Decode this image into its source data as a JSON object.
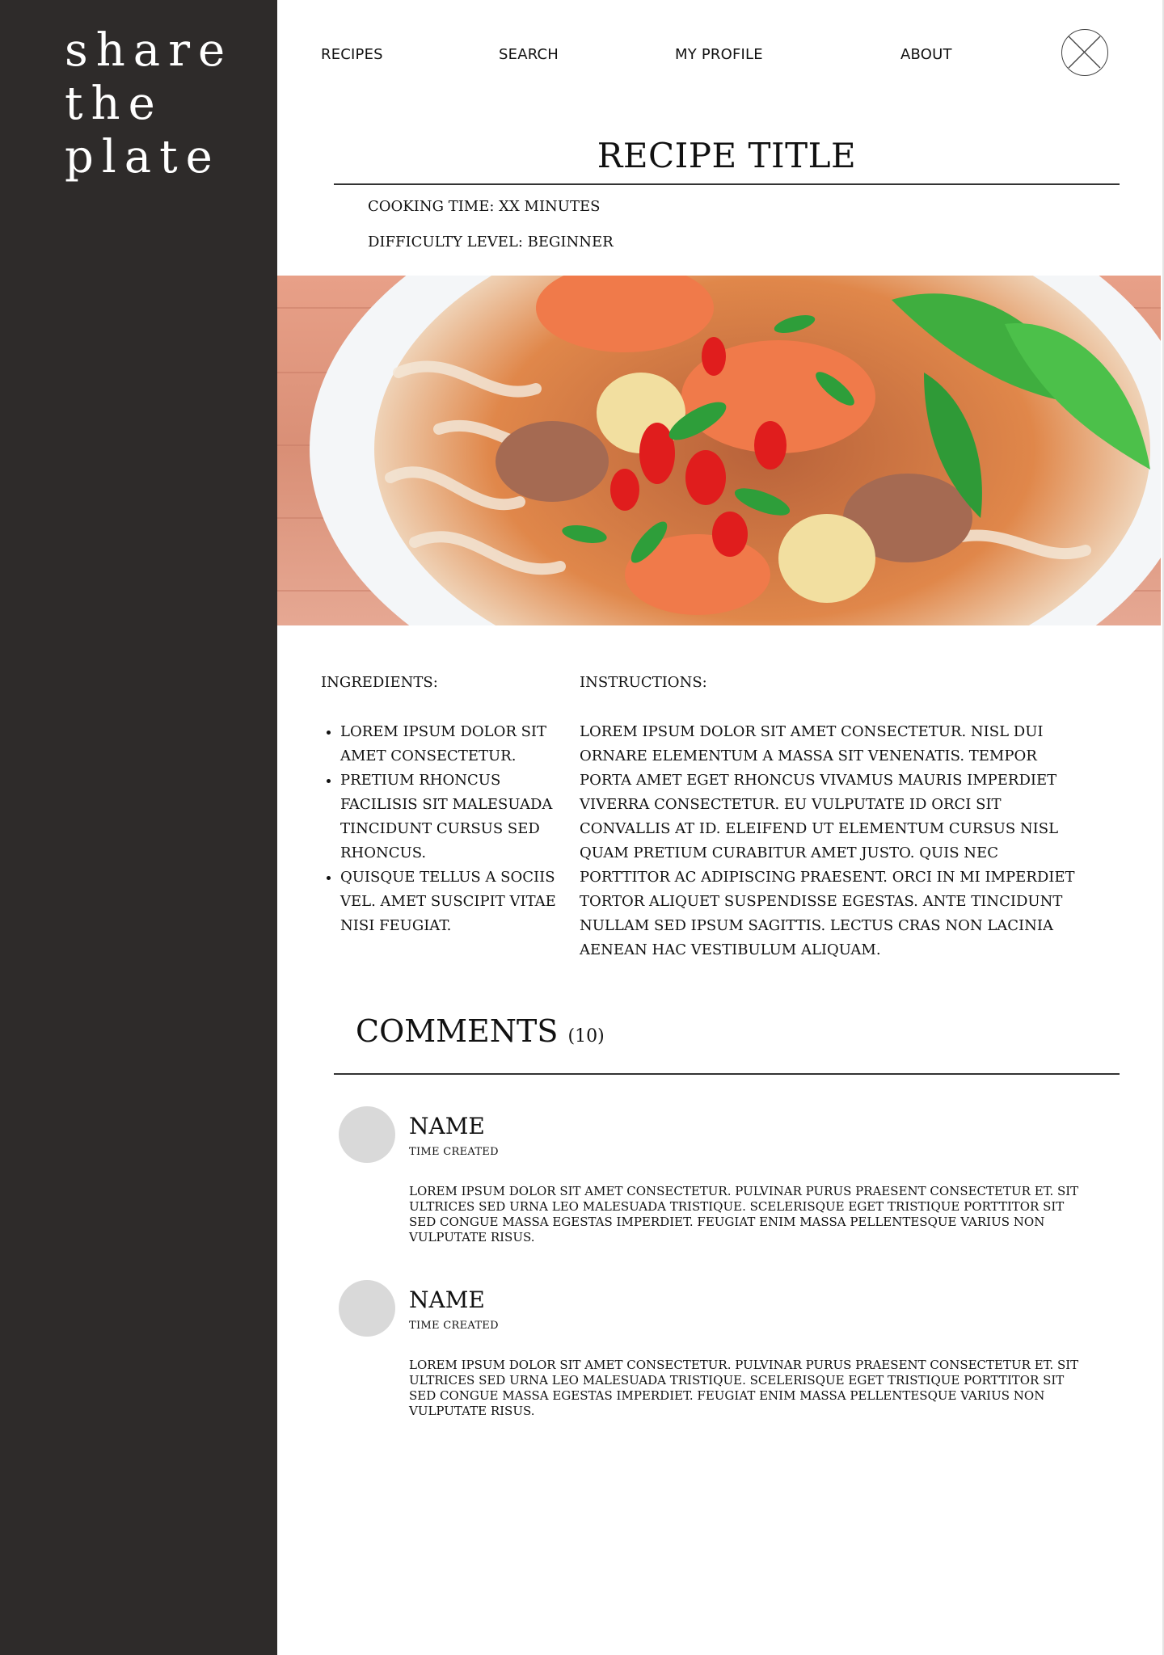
{
  "brand": {
    "logo_lines": [
      "share",
      "the",
      "plate"
    ]
  },
  "nav": {
    "items": [
      "RECIPES",
      "SEARCH",
      "MY PROFILE",
      "ABOUT"
    ]
  },
  "recipe": {
    "title": "RECIPE TITLE",
    "cooking_time": "COOKING TIME:  XX MINUTES",
    "difficulty": "DIFFICULTY LEVEL: BEGINNER",
    "ingredients_label": "INGREDIENTS:",
    "ingredients": [
      "LOREM IPSUM DOLOR SIT AMET CONSECTETUR.",
      "PRETIUM RHONCUS FACILISIS SIT MALESUADA TINCIDUNT CURSUS SED RHONCUS.",
      "QUISQUE TELLUS A SOCIIS VEL. AMET SUSCIPIT VITAE NISI FEUGIAT."
    ],
    "instructions_label": "INSTRUCTIONS:",
    "instructions": "LOREM IPSUM DOLOR SIT AMET CONSECTETUR. NISL DUI ORNARE ELEMENTUM A MASSA SIT VENENATIS. TEMPOR PORTA AMET EGET RHONCUS VIVAMUS MAURIS IMPERDIET VIVERRA CONSECTETUR. EU VULPUTATE ID ORCI SIT CONVALLIS AT ID. ELEIFEND UT ELEMENTUM CURSUS NISL QUAM PRETIUM CURABITUR AMET JUSTO. QUIS NEC PORTTITOR AC ADIPISCING PRAESENT. ORCI IN MI IMPERDIET TORTOR ALIQUET SUSPENDISSE EGESTAS. ANTE TINCIDUNT NULLAM SED IPSUM SAGITTIS. LECTUS CRAS NON LACINIA AENEAN HAC VESTIBULUM ALIQUAM."
  },
  "comments": {
    "label": "COMMENTS",
    "count": "(10)",
    "items": [
      {
        "name": "NAME",
        "time": "TIME CREATED",
        "body": "LOREM IPSUM DOLOR SIT AMET CONSECTETUR. PULVINAR PURUS PRAESENT CONSECTETUR ET. SIT ULTRICES SED URNA LEO MALESUADA TRISTIQUE. SCELERISQUE EGET TRISTIQUE PORTTITOR SIT SED CONGUE MASSA EGESTAS IMPERDIET. FEUGIAT ENIM MASSA PELLENTESQUE VARIUS NON VULPUTATE RISUS."
      },
      {
        "name": "NAME",
        "time": "TIME CREATED",
        "body": "LOREM IPSUM DOLOR SIT AMET CONSECTETUR. PULVINAR PURUS PRAESENT CONSECTETUR ET. SIT ULTRICES SED URNA LEO MALESUADA TRISTIQUE. SCELERISQUE EGET TRISTIQUE PORTTITOR SIT SED CONGUE MASSA EGESTAS IMPERDIET. FEUGIAT ENIM MASSA PELLENTESQUE VARIUS NON VULPUTATE RISUS."
      }
    ]
  },
  "colors": {
    "sidebar": "#2e2b2a",
    "avatar_placeholder": "#d9d9d9",
    "text": "#111111"
  },
  "icons": {
    "profile_avatar": "avatar-placeholder-icon"
  }
}
